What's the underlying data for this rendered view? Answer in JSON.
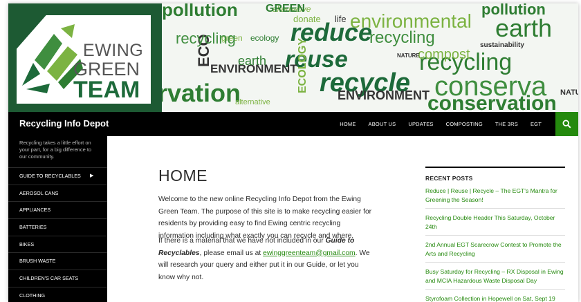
{
  "logo": {
    "line1": "EWING",
    "line2": "GREEN",
    "line3": "TEAM"
  },
  "banner_words": [
    "pollution",
    "alternative",
    "pollution",
    "reduce",
    "environmental",
    "earth",
    "recycling",
    "reuse",
    "recycling",
    "recycle",
    "ENVIRONMENT",
    "conserva",
    "rvation",
    "ECOLOGY",
    "ENVIRONMENT",
    "compost",
    "green",
    "donate",
    "life",
    "GREEN",
    "NATURE",
    "NATURE",
    "ECO",
    "ecology",
    "earth",
    "alternative",
    "sustainability",
    "conservation",
    "recycling"
  ],
  "site": {
    "title": "Recycling Info Depot",
    "tagline": "Recycling takes a little effort on your part, for a big difference to our community."
  },
  "topnav": [
    "HOME",
    "ABOUT US",
    "UPDATES",
    "COMPOSTING",
    "THE 3RS",
    "EGT"
  ],
  "sidebar": {
    "items": [
      "GUIDE TO RECYCLABLES",
      "AEROSOL CANS",
      "APPLIANCES",
      "BATTERIES",
      "BIKES",
      "BRUSH WASTE",
      "CHILDREN'S CAR SEATS",
      "CLOTHING"
    ]
  },
  "content": {
    "title": "HOME",
    "p1": "Welcome to the new online Recycling Info Depot from the Ewing Green Team. The purpose of this site is to make recycling easier for residents by providing easy to find Ewing centric recycling information including what exactly you can recycle and where.",
    "p2_before": "If there is a material that we have not included in our ",
    "p2_guide": "Guide to Recyclables",
    "p2_middle": ", please email us at ",
    "p2_email": "ewinggreenteam@gmail.com",
    "p2_after": ". We will research your query and either put it in our Guide, or let you know why not."
  },
  "recent_posts": {
    "title": "RECENT POSTS",
    "items": [
      "Reduce | Reuse | Recycle – The EGT's Mantra for Greening the Season!",
      "Recycling Double Header This Saturday, October 24th",
      "2nd Annual EGT Scarecrow Contest to Promote the Arts and Recycling",
      "Busy Saturday for Recycling – RX Disposal in Ewing and MCIA Hazardous Waste Disposal Day",
      "Styrofoam Collection in Hopewell on Sat, Sept 19"
    ]
  },
  "colors": {
    "brand_green": "#24890d",
    "dark_green": "#1d5a33",
    "topbar": "#000000"
  },
  "icons": {
    "search": "search-icon",
    "submenu": "caret-right-icon"
  }
}
